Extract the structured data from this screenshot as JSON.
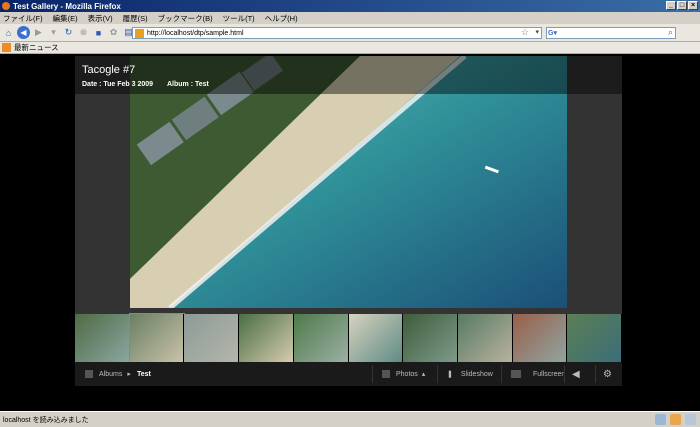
{
  "window": {
    "title": "Test Gallery - Mozilla Firefox"
  },
  "menu": [
    "ファイル(F)",
    "編集(E)",
    "表示(V)",
    "履歴(S)",
    "ブックマーク(B)",
    "ツール(T)",
    "ヘルプ(H)"
  ],
  "address": {
    "url": "http://localhost/dtp/sample.html"
  },
  "bookmarks": {
    "item": "最新ニュース"
  },
  "gallery": {
    "title": "Tacogle #7",
    "date": "Date : Tue Feb 3 2009",
    "album": "Album : Test"
  },
  "controls": {
    "albums": "Albums",
    "current_album": "Test",
    "photos": "Photos",
    "slideshow": "Slideshow",
    "fullscreen": "Fullscreen"
  },
  "status": {
    "text": "localhost を読み込みました"
  },
  "colors": {
    "titlebar": "#0a246a",
    "accent": "#3b6fd0",
    "gallery_bg": "#333333"
  }
}
